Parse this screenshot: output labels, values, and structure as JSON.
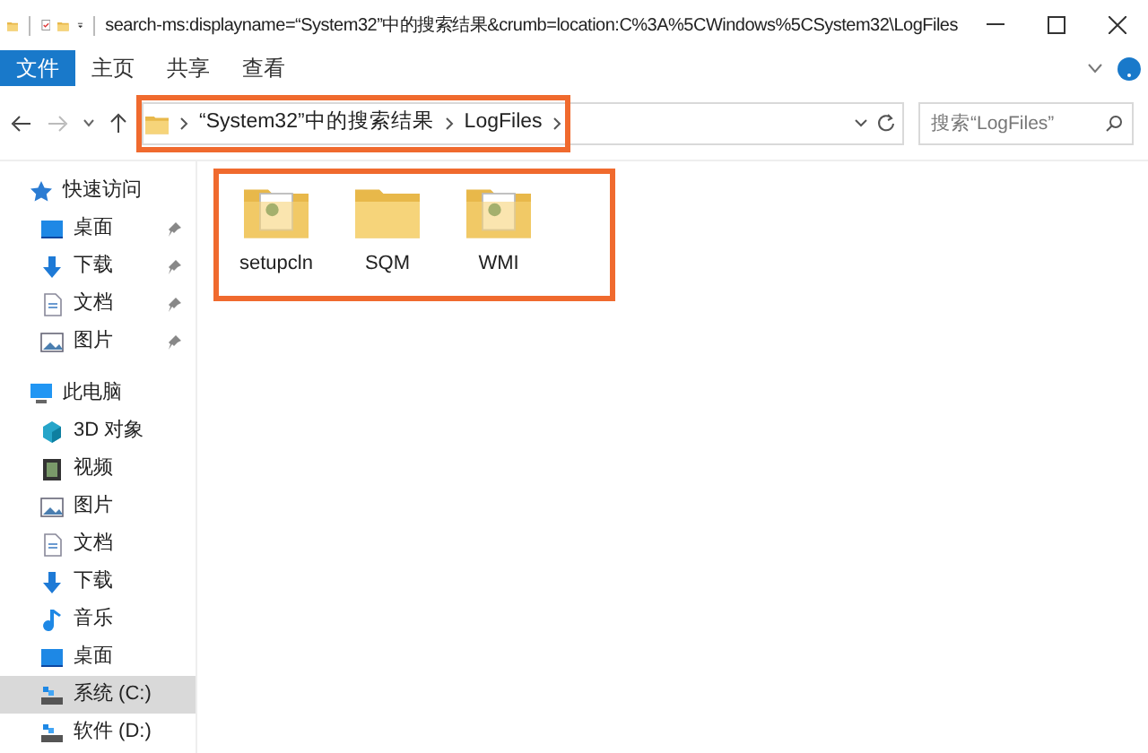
{
  "window": {
    "title": "search-ms:displayname=“System32”中的搜索结果&crumb=location:C%3A%5CWindows%5CSystem32\\LogFiles"
  },
  "ribbon_tabs": [
    {
      "label": "文件",
      "selected": true
    },
    {
      "label": "主页",
      "selected": false
    },
    {
      "label": "共享",
      "selected": false
    },
    {
      "label": "查看",
      "selected": false
    }
  ],
  "breadcrumb": [
    "“System32”中的搜索结果",
    "LogFiles"
  ],
  "search": {
    "placeholder": "搜索“LogFiles”"
  },
  "sidebar": [
    {
      "label": "快速访问",
      "kind": "star",
      "header": true,
      "pinned": false,
      "selected": false
    },
    {
      "label": "桌面",
      "kind": "desktop",
      "header": false,
      "pinned": true,
      "selected": false
    },
    {
      "label": "下载",
      "kind": "download",
      "header": false,
      "pinned": true,
      "selected": false
    },
    {
      "label": "文档",
      "kind": "document",
      "header": false,
      "pinned": true,
      "selected": false
    },
    {
      "label": "图片",
      "kind": "image",
      "header": false,
      "pinned": true,
      "selected": false
    },
    {
      "label": "此电脑",
      "kind": "pc",
      "header": true,
      "pinned": false,
      "selected": false
    },
    {
      "label": "3D 对象",
      "kind": "cube",
      "header": false,
      "pinned": false,
      "selected": false
    },
    {
      "label": "视频",
      "kind": "video",
      "header": false,
      "pinned": false,
      "selected": false
    },
    {
      "label": "图片",
      "kind": "image",
      "header": false,
      "pinned": false,
      "selected": false
    },
    {
      "label": "文档",
      "kind": "document",
      "header": false,
      "pinned": false,
      "selected": false
    },
    {
      "label": "下载",
      "kind": "download",
      "header": false,
      "pinned": false,
      "selected": false
    },
    {
      "label": "音乐",
      "kind": "music",
      "header": false,
      "pinned": false,
      "selected": false
    },
    {
      "label": "桌面",
      "kind": "desktop",
      "header": false,
      "pinned": false,
      "selected": false
    },
    {
      "label": "系统 (C:)",
      "kind": "drive",
      "header": false,
      "pinned": false,
      "selected": true
    },
    {
      "label": "软件 (D:)",
      "kind": "drive",
      "header": false,
      "pinned": false,
      "selected": false
    }
  ],
  "files": [
    {
      "name": "setupcln",
      "kind": "folder-doc"
    },
    {
      "name": "SQM",
      "kind": "folder"
    },
    {
      "name": "WMI",
      "kind": "folder-doc"
    }
  ]
}
